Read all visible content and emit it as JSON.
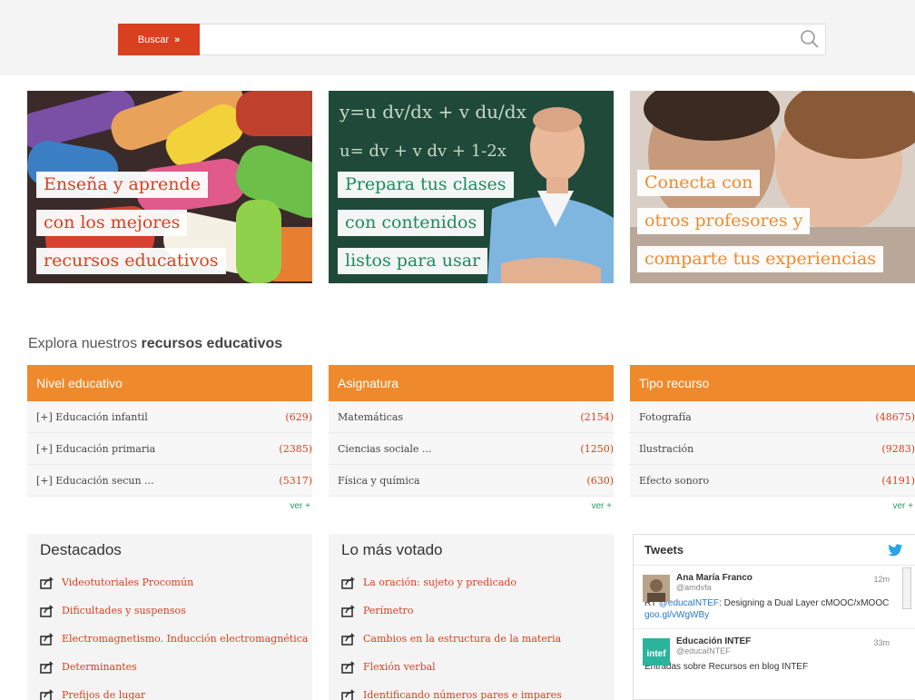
{
  "search": {
    "button_label": "Buscar",
    "button_arrows": "»",
    "placeholder": ""
  },
  "banners": [
    {
      "lines": [
        "Enseña y aprende",
        "con los mejores",
        "recursos educativos"
      ]
    },
    {
      "lines": [
        "Prepara tus clases",
        "con contenidos",
        "listos para usar"
      ],
      "board_text": [
        "y=u dv/dx + v du/dx",
        "u= dv + v dv + 1-2x"
      ]
    },
    {
      "lines": [
        "Conecta con",
        "otros profesores y",
        "comparte tus experiencias"
      ]
    }
  ],
  "explora": {
    "prefix": "Explora nuestros",
    "bold": "recursos educativos"
  },
  "panels": [
    {
      "title": "Nivel educativo",
      "rows": [
        {
          "label": "[+]  Educación infantil",
          "count": "(629)"
        },
        {
          "label": "[+]  Educación primaria",
          "count": "(2385)"
        },
        {
          "label": "[+]  Educación secun ...",
          "count": "(5317)"
        }
      ],
      "more": "ver +"
    },
    {
      "title": "Asignatura",
      "rows": [
        {
          "label": "Matemáticas",
          "count": "(2154)"
        },
        {
          "label": "Ciencias sociale ...",
          "count": "(1250)"
        },
        {
          "label": "Física y química",
          "count": "(630)"
        }
      ],
      "more": "ver +"
    },
    {
      "title": "Tipo recurso",
      "rows": [
        {
          "label": "Fotografía",
          "count": "(48675)"
        },
        {
          "label": "Ilustración",
          "count": "(9283)"
        },
        {
          "label": "Efecto sonoro",
          "count": "(4191)"
        }
      ],
      "more": "ver +"
    }
  ],
  "destacados": {
    "title": "Destacados",
    "items": [
      "Videotutoriales Procomún",
      "Dificultades y suspensos",
      "Electromagnetismo. Inducción electromagnética",
      "Determinantes",
      "Prefijos de lugar"
    ]
  },
  "votado": {
    "title": "Lo más votado",
    "items": [
      "La oración: sujeto y predicado",
      "Perímetro",
      "Cambios en la estructura de la materia",
      "Flexión verbal",
      "Identificando números pares e impares"
    ]
  },
  "tweets": {
    "title": "Tweets",
    "items": [
      {
        "name": "Ana María Franco",
        "handle": "@amdvfa",
        "time": "12m",
        "text_prefix": "RT ",
        "mention": "@educaINTEF",
        "text": ": Designing a Dual Layer cMOOC/xMOOC ",
        "link": "goo.gl/vWgWBy"
      },
      {
        "name": "Educación INTEF",
        "handle": "@educaINTEF",
        "time": "33m",
        "avatar_text": "intef",
        "text": "Entradas sobre Recursos en blog INTEF"
      }
    ]
  },
  "colors": {
    "red": "#d8401f",
    "orange": "#ef8a2c",
    "green": "#1e8a5e"
  }
}
